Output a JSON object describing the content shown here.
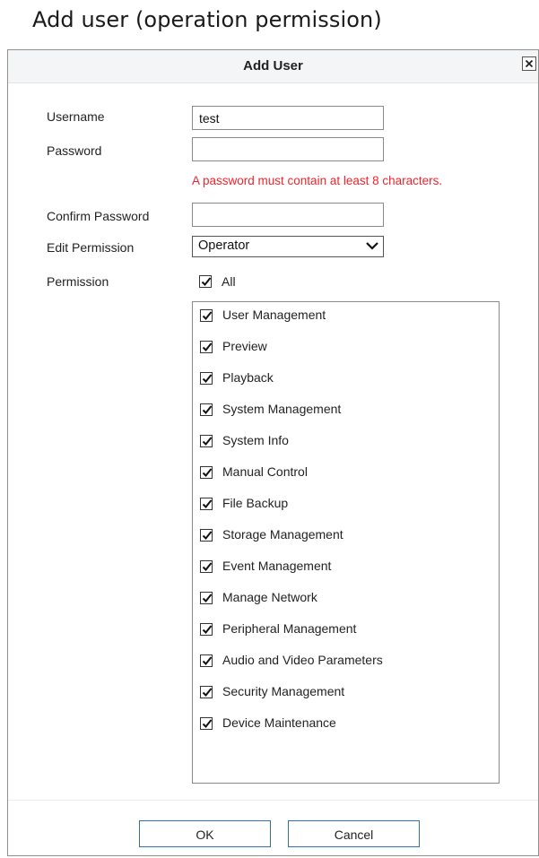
{
  "caption": "Add user (operation permission)",
  "dialog": {
    "title": "Add User",
    "close_icon": "close-icon"
  },
  "form": {
    "username_label": "Username",
    "username_value": "test",
    "password_label": "Password",
    "password_value": "",
    "password_hint": "A password must contain at least 8 characters.",
    "confirm_label": "Confirm Password",
    "confirm_value": "",
    "edit_permission_label": "Edit Permission",
    "edit_permission_value": "Operator",
    "permission_label": "Permission",
    "all_label": "All",
    "all_checked": true
  },
  "permissions": [
    {
      "label": "User Management",
      "checked": true
    },
    {
      "label": "Preview",
      "checked": true
    },
    {
      "label": "Playback",
      "checked": true
    },
    {
      "label": "System Management",
      "checked": true
    },
    {
      "label": "System Info",
      "checked": true
    },
    {
      "label": "Manual Control",
      "checked": true
    },
    {
      "label": "File Backup",
      "checked": true
    },
    {
      "label": "Storage Management",
      "checked": true
    },
    {
      "label": "Event Management",
      "checked": true
    },
    {
      "label": "Manage Network",
      "checked": true
    },
    {
      "label": "Peripheral Management",
      "checked": true
    },
    {
      "label": "Audio and Video Parameters",
      "checked": true
    },
    {
      "label": "Security Management",
      "checked": true
    },
    {
      "label": "Device Maintenance",
      "checked": true
    }
  ],
  "footer": {
    "ok_label": "OK",
    "cancel_label": "Cancel"
  },
  "colors": {
    "hint": "#e8262d",
    "button_border": "#2f6fb3",
    "titlebar_bg": "#f4f5f7"
  }
}
